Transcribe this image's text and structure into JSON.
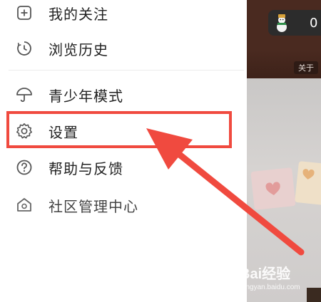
{
  "menu": {
    "items": [
      {
        "label": "我的关注",
        "icon": "plus-square-icon"
      },
      {
        "label": "浏览历史",
        "icon": "clock-icon"
      },
      {
        "label": "青少年模式",
        "icon": "umbrella-icon"
      },
      {
        "label": "设置",
        "icon": "gear-icon"
      },
      {
        "label": "帮助与反馈",
        "icon": "question-circle-icon"
      },
      {
        "label": "社区管理中心",
        "icon": "home-shield-icon"
      }
    ]
  },
  "backdrop": {
    "coin_count": "0",
    "about_label": "关于"
  },
  "watermark": {
    "brand": "Bai经验",
    "url": "jingyan.baidu.com"
  },
  "colors": {
    "highlight": "#f04a3f",
    "text": "#222222",
    "icon": "#555555"
  }
}
